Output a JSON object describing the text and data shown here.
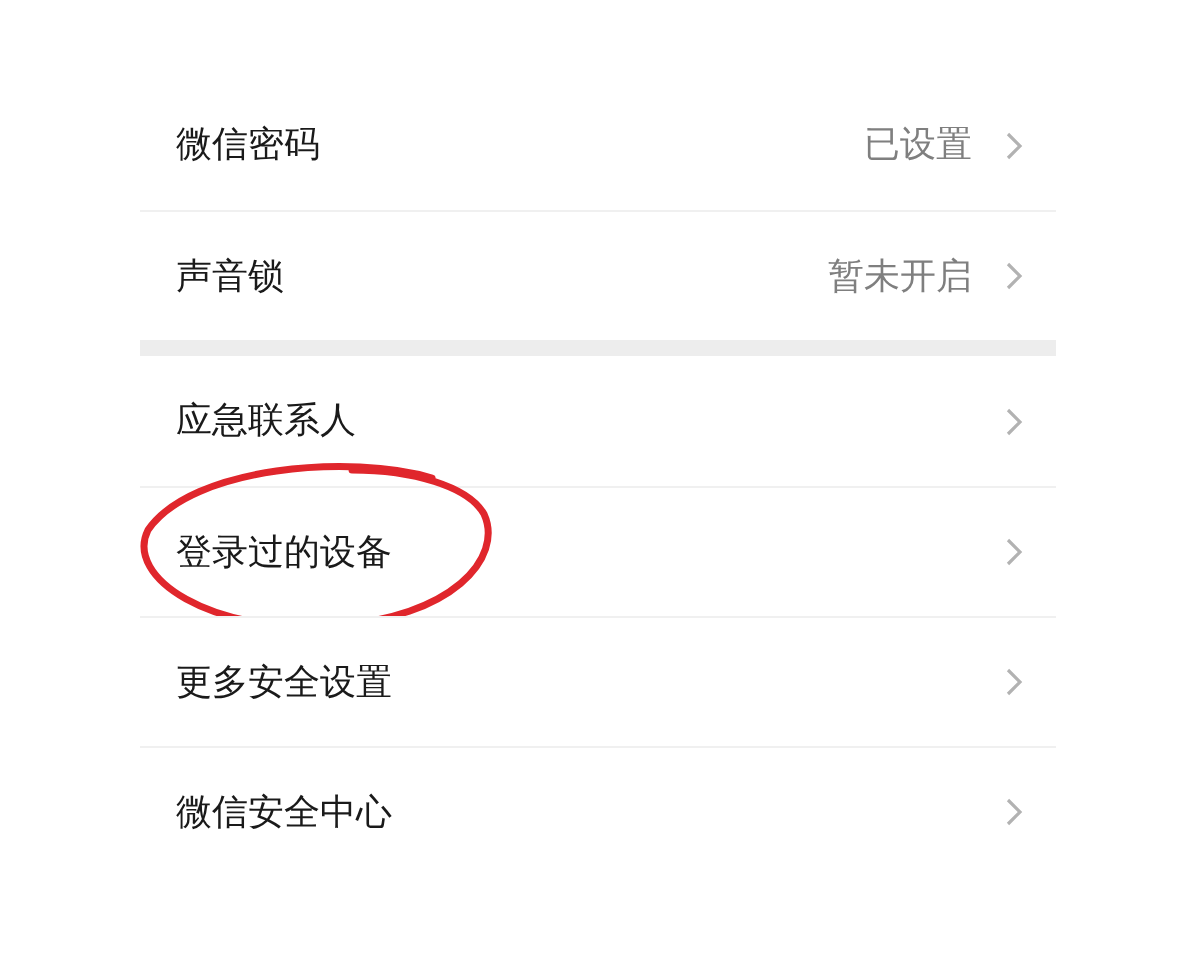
{
  "groups": [
    {
      "rows": [
        {
          "label": "微信密码",
          "value": "已设置"
        },
        {
          "label": "声音锁",
          "value": "暂未开启"
        }
      ]
    },
    {
      "rows": [
        {
          "label": "应急联系人"
        },
        {
          "label": "登录过的设备",
          "circled": true
        },
        {
          "label": "更多安全设置"
        },
        {
          "label": "微信安全中心"
        }
      ]
    }
  ]
}
